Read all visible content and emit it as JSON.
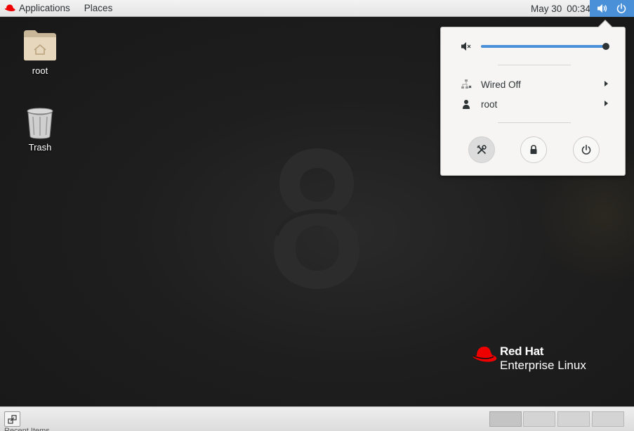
{
  "topbar": {
    "applications_label": "Applications",
    "places_label": "Places",
    "date": "May 30",
    "time": "00:34",
    "accent": "#4a90d9"
  },
  "desktop": {
    "icons": [
      {
        "label": "root",
        "icon": "home-folder-icon"
      },
      {
        "label": "Trash",
        "icon": "trash-icon"
      }
    ],
    "brand_line1": "Red Hat",
    "brand_line2": "Enterprise Linux",
    "brand_color": "#ee0000"
  },
  "system_menu": {
    "volume_level": 1.0,
    "network_label": "Wired Off",
    "user_label": "root",
    "buttons": [
      "settings-icon",
      "lock-icon",
      "power-icon"
    ]
  },
  "bottombar": {
    "workspaces": 4,
    "active_workspace": 1,
    "truncated_label": "Recent Items"
  }
}
